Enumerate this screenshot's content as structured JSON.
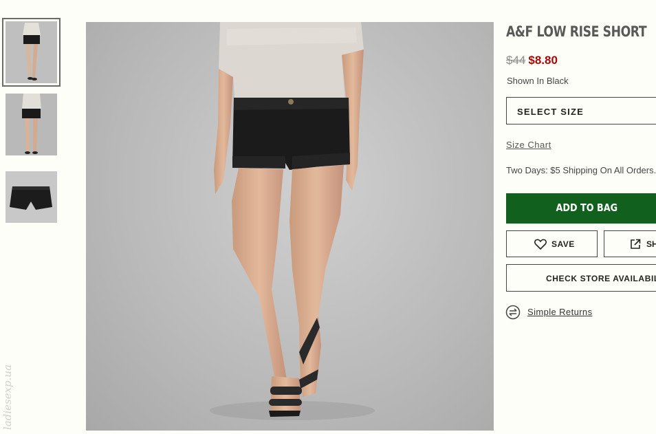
{
  "product": {
    "title": "A&F LOW RISE SHORT",
    "old_price": "$44",
    "sale_price": "$8.80",
    "color_text": "Shown In Black"
  },
  "actions": {
    "select_size_label": "SELECT SIZE",
    "size_chart_label": "Size Chart",
    "shipping_text": "Two Days: $5 Shipping On All Orders.",
    "add_to_bag_label": "ADD TO BAG",
    "save_label": "SAVE",
    "share_label": "SH",
    "store_availability_label": "CHECK STORE AVAILABILITY",
    "returns_label": "Simple Returns"
  },
  "gallery": {
    "thumbnails": [
      {
        "icon": "model-front-thumbnail"
      },
      {
        "icon": "model-back-thumbnail"
      },
      {
        "icon": "shorts-flat-thumbnail"
      }
    ],
    "selected_index": 0
  },
  "watermark": "ladiesexp.ua",
  "colors": {
    "sale_price": "#a50a0a",
    "add_to_bag_bg": "#11601e",
    "page_bg": "#fefef8"
  }
}
